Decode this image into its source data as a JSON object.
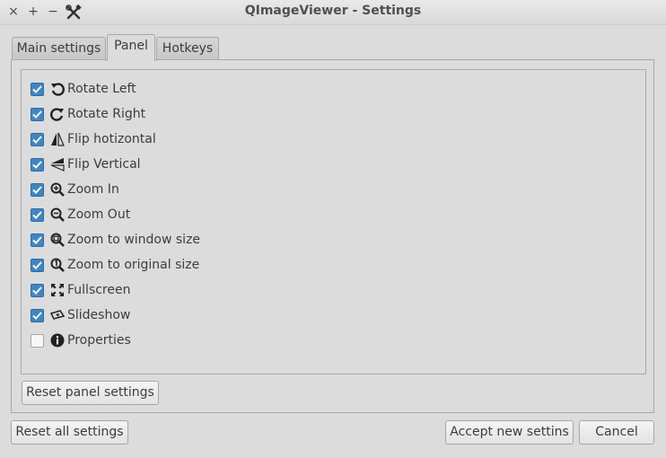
{
  "window": {
    "title": "QImageViewer - Settings",
    "close_glyph": "×",
    "maximize_glyph": "+",
    "minimize_glyph": "−",
    "app_icon": "tools-icon"
  },
  "tabs": [
    {
      "label": "Main settings",
      "active": false
    },
    {
      "label": "Panel",
      "active": true
    },
    {
      "label": "Hotkeys",
      "active": false
    }
  ],
  "panel": {
    "items": [
      {
        "label": "Rotate Left",
        "checked": true,
        "icon": "rotate-left-icon"
      },
      {
        "label": "Rotate Right",
        "checked": true,
        "icon": "rotate-right-icon"
      },
      {
        "label": "Flip hotizontal",
        "checked": true,
        "icon": "flip-horizontal-icon"
      },
      {
        "label": "Flip Vertical",
        "checked": true,
        "icon": "flip-vertical-icon"
      },
      {
        "label": "Zoom In",
        "checked": true,
        "icon": "zoom-in-icon"
      },
      {
        "label": "Zoom Out",
        "checked": true,
        "icon": "zoom-out-icon"
      },
      {
        "label": "Zoom to window size",
        "checked": true,
        "icon": "zoom-fit-icon"
      },
      {
        "label": "Zoom to original size",
        "checked": true,
        "icon": "zoom-original-icon"
      },
      {
        "label": "Fullscreen",
        "checked": true,
        "icon": "fullscreen-icon"
      },
      {
        "label": "Slideshow",
        "checked": true,
        "icon": "slideshow-icon"
      },
      {
        "label": "Properties",
        "checked": false,
        "icon": "info-icon"
      }
    ],
    "reset_label": "Reset panel settings"
  },
  "footer": {
    "reset_all_label": "Reset all settings",
    "accept_label": "Accept new settins",
    "cancel_label": "Cancel"
  },
  "colors": {
    "checkbox_on": "#3d86c6",
    "window_bg": "#dcdcdc"
  }
}
